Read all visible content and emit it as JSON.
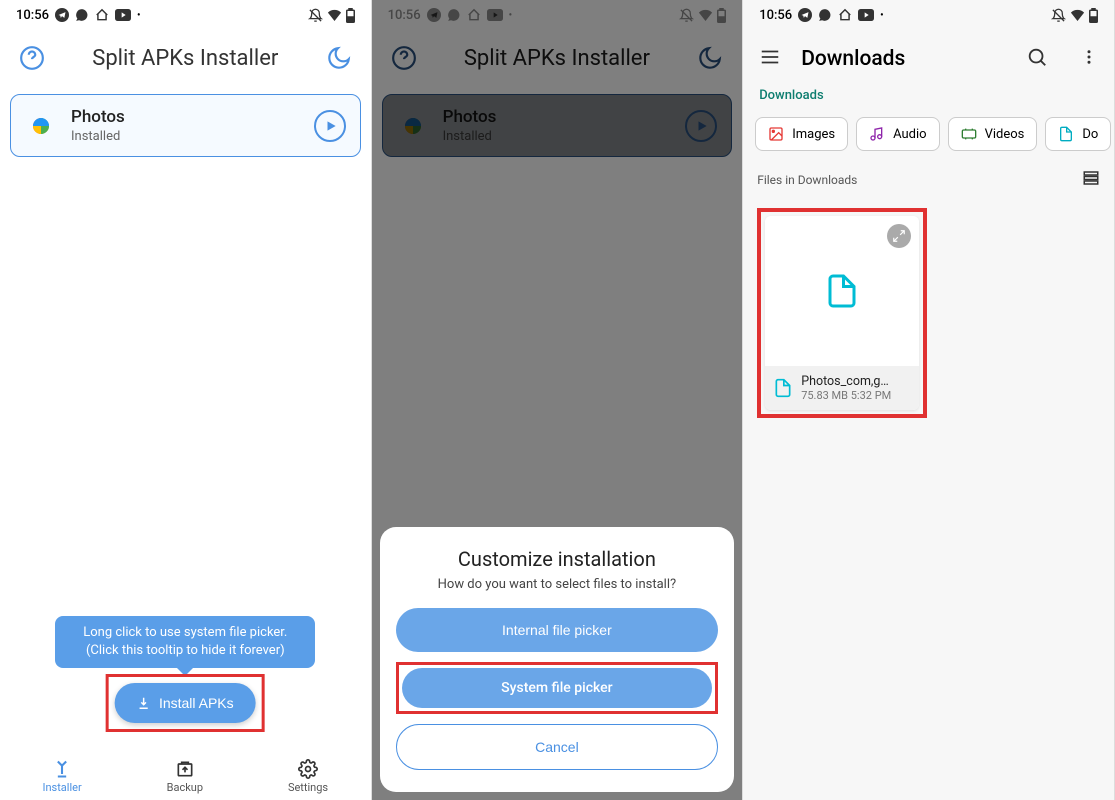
{
  "status": {
    "time": "10:56"
  },
  "app": {
    "title": "Split APKs Installer",
    "card": {
      "name": "Photos",
      "status": "Installed"
    },
    "tooltip_line1": "Long click to use system file picker.",
    "tooltip_line2": "(Click this tooltip to hide it forever)",
    "install_btn": "Install APKs",
    "nav": {
      "installer": "Installer",
      "backup": "Backup",
      "settings": "Settings"
    }
  },
  "sheet": {
    "title": "Customize installation",
    "subtitle": "How do you want to select files to install?",
    "internal": "Internal file picker",
    "system": "System file picker",
    "cancel": "Cancel"
  },
  "downloads": {
    "title": "Downloads",
    "crumb": "Downloads",
    "chips": {
      "images": "Images",
      "audio": "Audio",
      "videos": "Videos",
      "docs": "Do"
    },
    "files_in": "Files in Downloads",
    "file": {
      "name": "Photos_com,g…",
      "size": "75.83 MB",
      "time": "5:32 PM"
    }
  },
  "colors": {
    "accent": "#4a90e2",
    "highlight": "#e03131",
    "teal": "#0d7d6f"
  }
}
